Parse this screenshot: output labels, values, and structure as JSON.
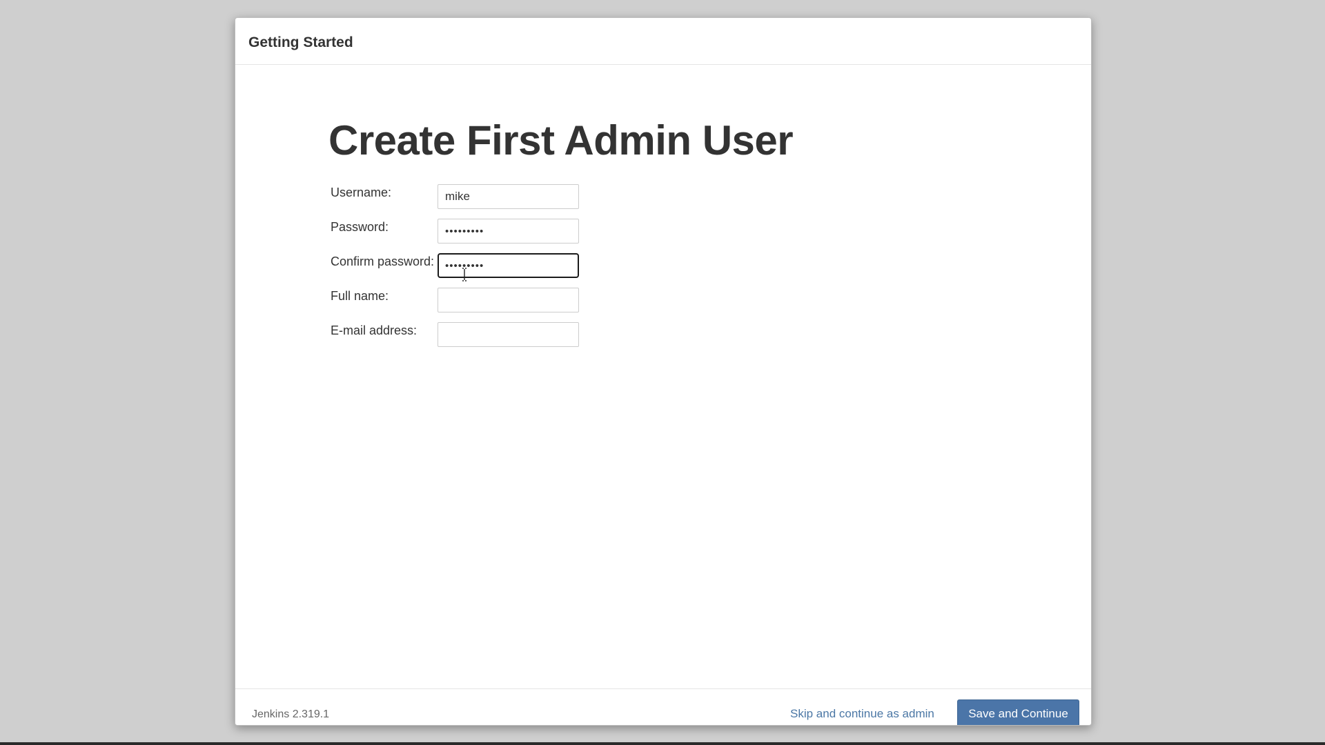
{
  "dialog": {
    "title": "Getting Started"
  },
  "page": {
    "heading": "Create First Admin User"
  },
  "form": {
    "fields": [
      {
        "label": "Username:",
        "value": "mike",
        "type": "text"
      },
      {
        "label": "Password:",
        "value": "•••••••••",
        "type": "password"
      },
      {
        "label": "Confirm password:",
        "value": "•••••••••",
        "type": "password",
        "focused": true
      },
      {
        "label": "Full name:",
        "value": "",
        "type": "text"
      },
      {
        "label": "E-mail address:",
        "value": "",
        "type": "text"
      }
    ]
  },
  "footer": {
    "version": "Jenkins 2.319.1",
    "skip_label": "Skip and continue as admin",
    "save_label": "Save and Continue"
  },
  "colors": {
    "primary_button": "#4b75a8",
    "link": "#4b77a5"
  },
  "icons": {
    "cursor": "text-cursor-icon"
  }
}
